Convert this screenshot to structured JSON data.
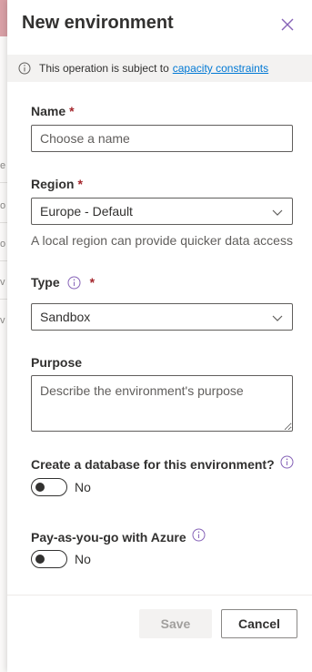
{
  "panel": {
    "title": "New environment"
  },
  "notice": {
    "text": "This operation is subject to",
    "link": "capacity constraints"
  },
  "form": {
    "name": {
      "label": "Name",
      "required_mark": "*",
      "placeholder": "Choose a name",
      "value": ""
    },
    "region": {
      "label": "Region",
      "required_mark": "*",
      "value": "Europe - Default",
      "help": "A local region can provide quicker data access"
    },
    "type": {
      "label": "Type",
      "required_mark": "*",
      "value": "Sandbox"
    },
    "purpose": {
      "label": "Purpose",
      "placeholder": "Describe the environment's purpose"
    },
    "database": {
      "label": "Create a database for this environment?",
      "state": "No",
      "on": false
    },
    "payg": {
      "label": "Pay-as-you-go with Azure",
      "state": "No",
      "on": false
    }
  },
  "footer": {
    "save_label": "Save",
    "cancel_label": "Cancel"
  },
  "background": {
    "fragments": [
      "e",
      "o",
      "o",
      "v",
      "v"
    ]
  },
  "colors": {
    "accent": "#8764b8",
    "link": "#0078d4",
    "required": "#a4262c",
    "text": "#323130",
    "disabled_bg": "#f3f2f1"
  }
}
